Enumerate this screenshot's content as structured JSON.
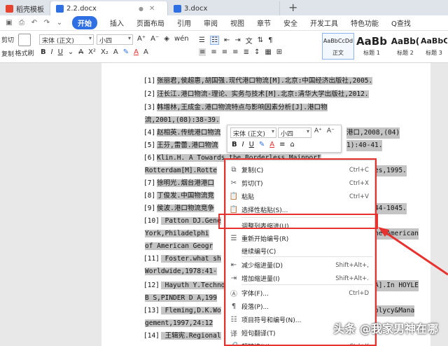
{
  "tabs": [
    {
      "label": "稻壳模板",
      "color": "#e8432f"
    },
    {
      "label": "2.2.docx",
      "color": "#2f6fe4"
    },
    {
      "label": "3.docx",
      "color": "#2f6fe4"
    }
  ],
  "menus": [
    "开始",
    "插入",
    "页面布局",
    "引用",
    "审阅",
    "视图",
    "章节",
    "安全",
    "开发工具",
    "特色功能",
    "Q查找"
  ],
  "ribbon": {
    "cut_label": "剪切",
    "copy_label": "复制",
    "format_painter_label": "格式刷",
    "font": "宋体 (正文)",
    "size": "小四",
    "styles": [
      {
        "preview": "AaBbCcDd",
        "name": "正文"
      },
      {
        "preview": "AaBb",
        "name": "标题 1"
      },
      {
        "preview": "AaBb(",
        "name": "标题 2"
      },
      {
        "preview": "AaBbC",
        "name": "标题 3"
      }
    ]
  },
  "references": [
    {
      "n": "[1]",
      "text": "张丽君,侯超惠,胡国强.现代港口物流[M].北京:中国经济出版社,2005."
    },
    {
      "n": "[2]",
      "text": "汪长江.港口物流-理论、实务与技术[M].北京:清华大学出版社,2012."
    },
    {
      "n": "[3]",
      "text": "韩增林,王成金.港口物流特点与影响因素分析[J].港口物"
    },
    {
      "n": "",
      "text": "流,2001,(08):38-39."
    },
    {
      "n": "[4]",
      "text": "赵相英.传统港口物流",
      "tail": "港口,2008,(04)"
    },
    {
      "n": "[5]",
      "text": "王芬,雷蕾.港口物流",
      "tail": "1):40-41."
    },
    {
      "n": "[6]",
      "text": "Klin.H. A Towards the Borderless Mainport"
    },
    {
      "n": "",
      "text": "Rotterdam[M].Rotte",
      "tail": "es,1995."
    },
    {
      "n": "[7]",
      "text": "徐明光.烟台港港口"
    },
    {
      "n": "[8]",
      "text": "丁俊发.中国物流竞"
    },
    {
      "n": "[9]",
      "text": "侯波.港口物流竞争",
      "tail": "44-1045."
    },
    {
      "n": "[10]",
      "text": "  Patton DJ.Gene"
    },
    {
      "n": "",
      "text": "York,Philadelphi",
      "tail": "he American"
    },
    {
      "n": "",
      "text": "of American Geogr"
    },
    {
      "n": "[11]",
      "text": "  Foster.what sh"
    },
    {
      "n": "",
      "text": "Worldwide,1978:41-"
    },
    {
      "n": "[12]",
      "text": "  Hayuth Y.Techno",
      "tail": "A].In HOYLE"
    },
    {
      "n": "",
      "text": "B S,PINDER D A,199"
    },
    {
      "n": "[13]",
      "text": "  Fleming,D.K.Wo",
      "tail": "olycy&Mana"
    },
    {
      "n": "",
      "text": "gement,1997,24:12"
    },
    {
      "n": "[14]",
      "text": "  王辑宪.Regional"
    }
  ],
  "mini_toolbar": {
    "font": "宋体 (正文)",
    "size": "小四"
  },
  "context_menu": [
    {
      "icon": "copy-icon",
      "glyph": "⧉",
      "label": "复制(C)",
      "shortcut": "Ctrl+C"
    },
    {
      "icon": "cut-icon",
      "glyph": "✂",
      "label": "剪切(T)",
      "shortcut": "Ctrl+X"
    },
    {
      "icon": "paste-icon",
      "glyph": "📋",
      "label": "粘贴",
      "shortcut": "Ctrl+V"
    },
    {
      "icon": "paste-special-icon",
      "glyph": "📋",
      "label": "选择性粘贴(S)...",
      "shortcut": ""
    },
    {
      "icon": "",
      "glyph": "",
      "label": "调整列表缩进(U)...",
      "shortcut": ""
    },
    {
      "icon": "restart-numbering-icon",
      "glyph": "☰",
      "label": "重新开始编号(R)",
      "shortcut": ""
    },
    {
      "icon": "",
      "glyph": "",
      "label": "继续编号(C)",
      "shortcut": ""
    },
    {
      "icon": "decrease-indent-icon",
      "glyph": "⇤",
      "label": "减少缩进量(D)",
      "shortcut": "Shift+Alt+,"
    },
    {
      "icon": "increase-indent-icon",
      "glyph": "⇥",
      "label": "增加缩进量(I)",
      "shortcut": "Shift+Alt+."
    },
    {
      "icon": "font-icon",
      "glyph": "Ⓐ",
      "label": "字体(F)...",
      "shortcut": "Ctrl+D"
    },
    {
      "icon": "paragraph-icon",
      "glyph": "¶",
      "label": "段落(P)...",
      "shortcut": ""
    },
    {
      "icon": "bullets-numbering-icon",
      "glyph": "☷",
      "label": "项目符号和编号(N)...",
      "shortcut": ""
    },
    {
      "icon": "translate-icon",
      "glyph": "译",
      "label": "短句翻译(T)",
      "shortcut": ""
    },
    {
      "icon": "hyperlink-icon",
      "glyph": "🔗",
      "label": "超链接(H)...",
      "shortcut": "Ctrl+K"
    }
  ],
  "watermark": "头条 @我家男神在哪",
  "accent_color": "#2f6fe4",
  "annotation_color": "#e8322f"
}
